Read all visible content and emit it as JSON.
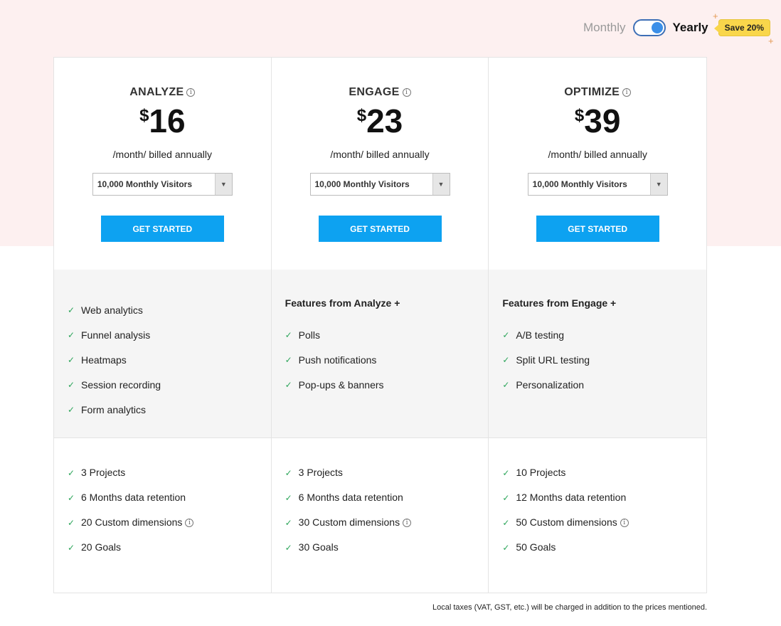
{
  "billing": {
    "monthly_label": "Monthly",
    "yearly_label": "Yearly",
    "selected": "Yearly",
    "save_badge": "Save 20%",
    "accent_color": "#3b8fe8"
  },
  "plans": [
    {
      "name": "ANALYZE",
      "currency": "$",
      "price": "16",
      "period": "/month/ billed annually",
      "visitors": "10,000 Monthly Visitors",
      "cta": "GET STARTED",
      "features_intro": "",
      "features": [
        "Web analytics",
        "Funnel analysis",
        "Heatmaps",
        "Session recording",
        "Form analytics"
      ],
      "limits": [
        "3 Projects",
        "6 Months data retention",
        "20 Custom dimensions",
        "20 Goals"
      ]
    },
    {
      "name": "ENGAGE",
      "currency": "$",
      "price": "23",
      "period": "/month/ billed annually",
      "visitors": "10,000 Monthly Visitors",
      "cta": "GET STARTED",
      "features_intro": "Features from Analyze +",
      "features": [
        "Polls",
        "Push notifications",
        "Pop-ups & banners"
      ],
      "limits": [
        "3 Projects",
        "6 Months data retention",
        "30 Custom dimensions",
        "30 Goals"
      ]
    },
    {
      "name": "OPTIMIZE",
      "currency": "$",
      "price": "39",
      "period": "/month/ billed annually",
      "visitors": "10,000 Monthly Visitors",
      "cta": "GET STARTED",
      "features_intro": "Features from Engage +",
      "features": [
        "A/B testing",
        "Split URL testing",
        "Personalization"
      ],
      "limits": [
        "10 Projects",
        "12 Months data retention",
        "50 Custom dimensions",
        "50 Goals"
      ]
    }
  ],
  "tax_note": "Local taxes (VAT, GST, etc.) will be charged in addition to the prices mentioned.",
  "colors": {
    "cta": "#0da2f1",
    "check": "#2ca55a",
    "hero_background": "#fdf0f0",
    "badge": "#f9d64b"
  }
}
